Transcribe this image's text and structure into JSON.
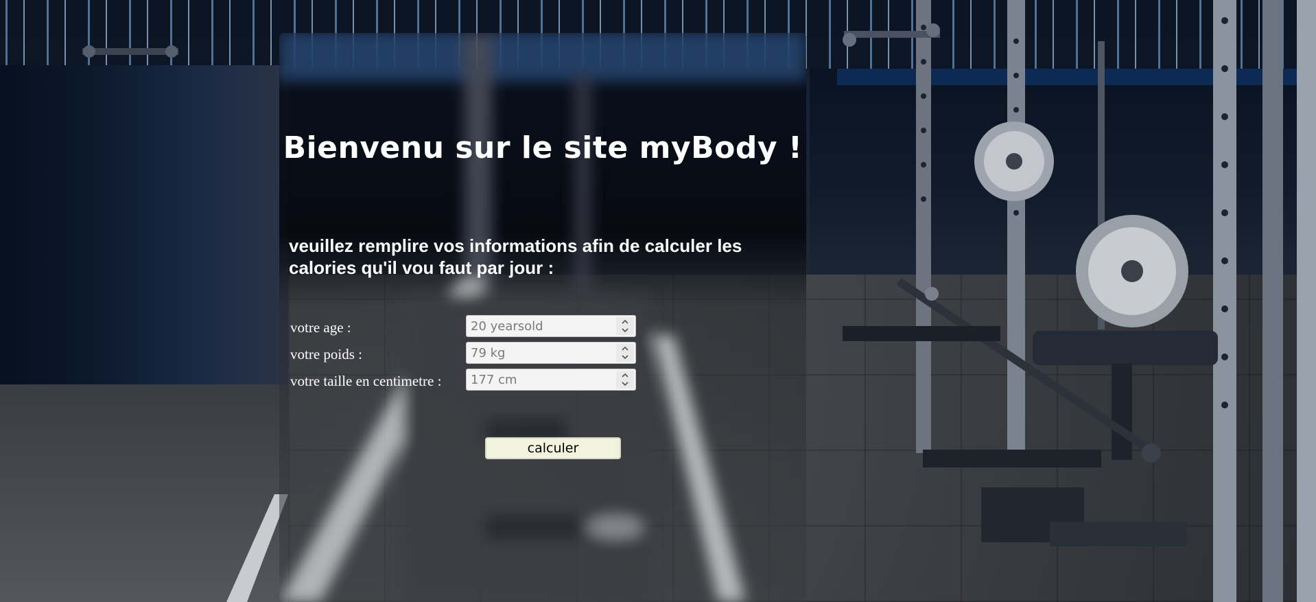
{
  "page": {
    "title": "Bienvenu sur le site myBody !",
    "subtitle": "veuillez remplire vos informations afin de calculer les calories qu'il vou faut par jour :"
  },
  "form": {
    "fields": [
      {
        "label": "votre age :",
        "placeholder": "20 yearsold"
      },
      {
        "label": "votre poids :",
        "placeholder": "79 kg"
      },
      {
        "label": "votre taille en centimetre :",
        "placeholder": "177 cm"
      }
    ],
    "submit_label": "calculer"
  },
  "icons": {
    "spinner_up": "chevron-up-icon",
    "spinner_down": "chevron-down-icon"
  },
  "colors": {
    "text": "#ffffff",
    "button_bg": "#f2f3de"
  }
}
